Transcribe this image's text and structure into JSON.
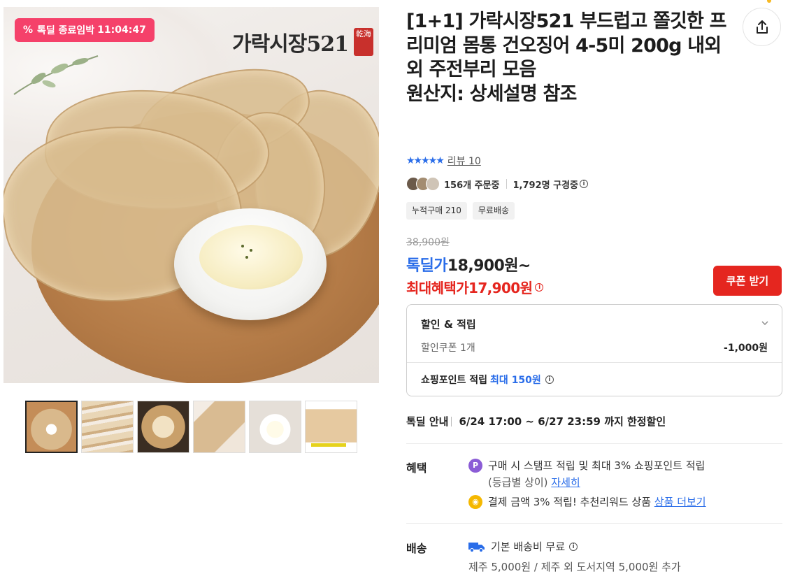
{
  "image": {
    "deal_timer_icon": "percent-icon",
    "deal_timer_label": "톡딜 종료임박",
    "deal_timer_time": "11:04:47",
    "brand_watermark": "가락시장521",
    "brand_seal": "乾海"
  },
  "thumbnails": [
    {
      "label": "thumbnail-1",
      "active": true
    },
    {
      "label": "thumbnail-2",
      "active": false
    },
    {
      "label": "thumbnail-3",
      "active": false
    },
    {
      "label": "thumbnail-4",
      "active": false
    },
    {
      "label": "thumbnail-5",
      "active": false
    },
    {
      "label": "thumbnail-6",
      "active": false
    }
  ],
  "product": {
    "title": "[1+1] 가락시장521 부드럽고 쫄깃한 프리미엄 몸통 건오징어 4-5미 200g 내외 외 주전부리 모음",
    "origin": "원산지: 상세설명 참조",
    "rating_stars": "★★★★★",
    "review_link": "리뷰 10",
    "orders": "156개 주문중",
    "viewers": "1,792명 구경중",
    "tags": [
      "누적구매 210",
      "무료배송"
    ]
  },
  "price": {
    "original": "38,900원",
    "deal_label": "톡딜가",
    "deal_value": "18,900원~",
    "max_label": "최대혜택가",
    "max_value": "17,900원",
    "coupon_button": "쿠폰 받기"
  },
  "discount_box": {
    "title": "할인 & 적립",
    "coupon_label": "할인쿠폰 1개",
    "coupon_value": "-1,000원",
    "point_label": "쇼핑포인트 적립",
    "point_max_prefix": "최대",
    "point_max_value": "150원"
  },
  "deal_guide": {
    "label": "톡딜 안내",
    "period": "6/24 17:00 ~ 6/27 23:59 까지 한정할인"
  },
  "benefits": {
    "label": "혜택",
    "item1_icon": "P",
    "item1_text": "구매 시 스탬프 적립 및 최대 3% 쇼핑포인트 적립",
    "item1_sub": "(등급별 상이)",
    "item1_link": "자세히",
    "item2_text": "결제 금액 3% 적립! 추천리워드 상품",
    "item2_link": "상품 더보기"
  },
  "shipping": {
    "label": "배송",
    "line1": "기본 배송비 무료",
    "line2": "제주 5,000원 / 제주 외 도서지역 5,000원 추가"
  },
  "colors": {
    "accent_blue": "#2a6de9",
    "accent_red": "#e5261f",
    "deal_pink": "#f5416a"
  }
}
